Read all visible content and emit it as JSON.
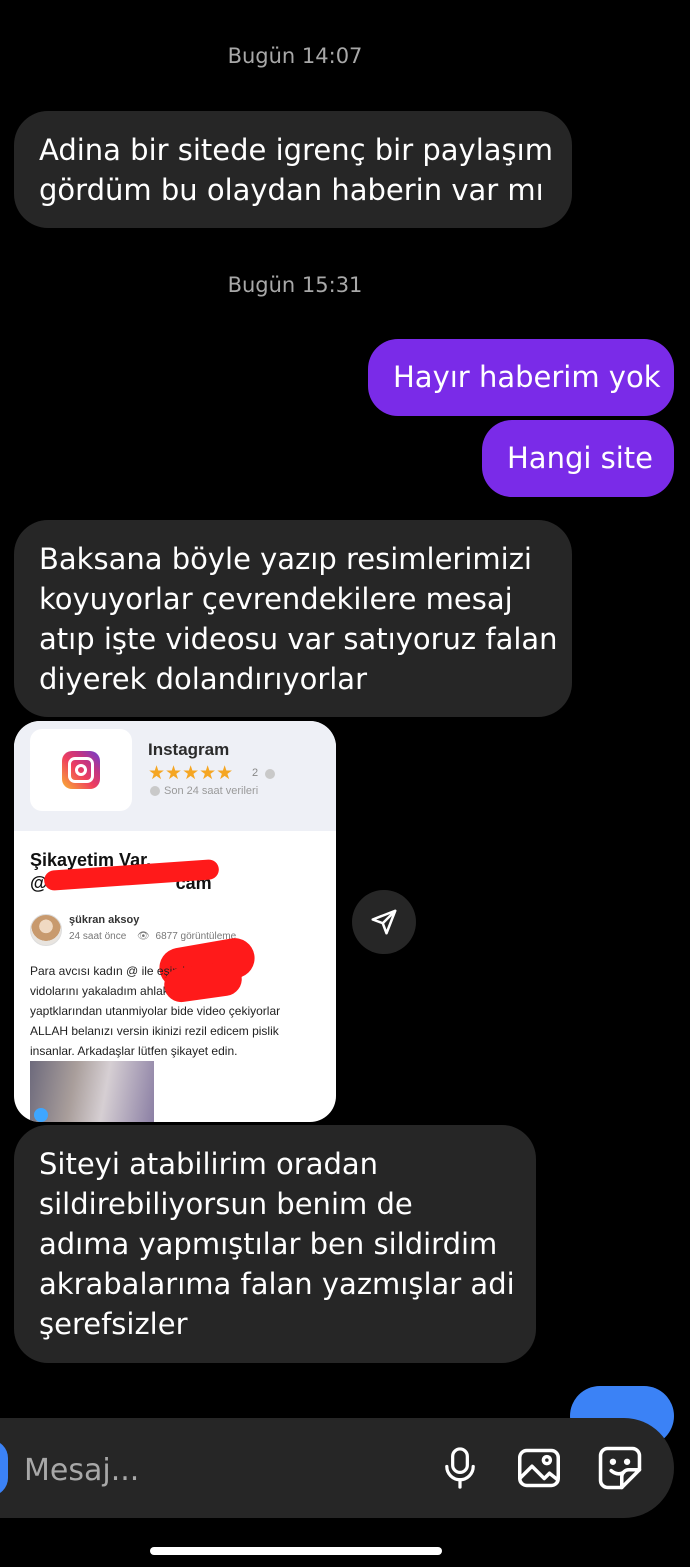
{
  "thread": {
    "timestamps": [
      "Bugün 14:07",
      "Bugün 15:31"
    ],
    "messages": [
      {
        "lines": [
          "Adina bir sitede igrenç bir paylaşım",
          "gördüm bu olaydan haberin var mı"
        ]
      },
      {
        "lines": [
          "Hayır haberim yok"
        ]
      },
      {
        "lines": [
          "Hangi site"
        ]
      },
      {
        "lines": [
          "Baksana böyle yazıp resimlerimizi",
          "koyuyorlar çevrendekilere mesaj",
          "atıp işte videosu var satıyoruz falan",
          "diyerek dolandırıyorlar"
        ]
      },
      {
        "lines": [
          "Siteyi atabilirim oradan",
          "sildirebiliyorsun benim de",
          "adıma yapmıştılar ben sildirdim",
          "akrabalarıma falan yazmışlar adi",
          "şerefsizler"
        ]
      }
    ]
  },
  "shared_post": {
    "site_name": "Instagram",
    "stars": "★★★★★",
    "rating_count": "2",
    "stats_note": "Son 24 saat verileri",
    "title": "Şikayetim Var,",
    "handle_prefix": "@",
    "handle_suffix": "cam",
    "author": "şükran aksoy",
    "time": "24 saat önce",
    "views": "6877 görüntüleme",
    "body_lines": [
      "Para avcısı kadın @                          ile eşimin",
      "vidolarını yakaladım ahlaksız insanlar",
      "yaptklarından utanmiyolar bide video çekiyorlar",
      "ALLAH belanızı versin ikinizi rezil edicem pislik",
      "insanlar. Arkadaşlar lütfen şikayet edin."
    ]
  },
  "composer": {
    "placeholder": "Mesaj...",
    "icons": [
      "mic-icon",
      "gallery-icon",
      "sticker-icon"
    ]
  },
  "colors": {
    "incoming_bubble": "#262626",
    "outgoing_bubble": "#7a2be8",
    "accent_blue": "#3b82f6",
    "redaction": "#ff1a1a"
  }
}
